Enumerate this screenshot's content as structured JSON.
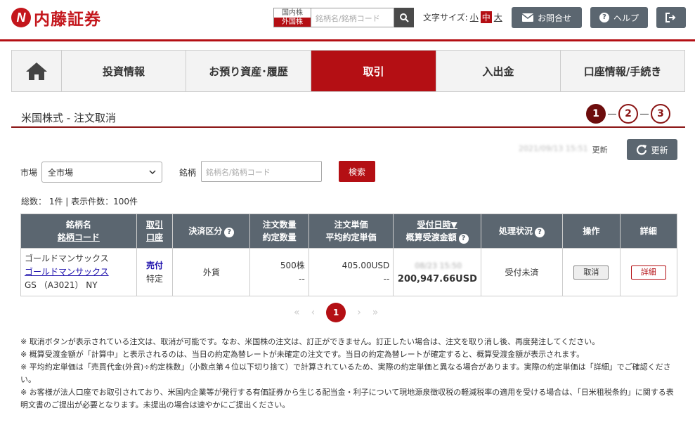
{
  "brand": {
    "logo_mark": "N",
    "name": "内藤証券"
  },
  "header": {
    "market_domestic": "国内株",
    "market_foreign": "外国株",
    "search_placeholder": "銘柄名/銘柄コード",
    "font_size_label": "文字サイズ:",
    "font_small": "小",
    "font_medium": "中",
    "font_large": "大",
    "contact_label": "お問合せ",
    "help_label": "ヘルプ"
  },
  "nav": {
    "items": [
      {
        "label": "投資情報"
      },
      {
        "label": "お預り資産･履歴"
      },
      {
        "label": "取引"
      },
      {
        "label": "入出金"
      },
      {
        "label": "口座情報/手続き"
      }
    ]
  },
  "page": {
    "title": "米国株式 - 注文取消",
    "steps": [
      "1",
      "2",
      "3"
    ],
    "updated_ts": "2021/09/13 15:51",
    "updated_label": "更新",
    "refresh_label": "更新"
  },
  "filters": {
    "market_label": "市場",
    "market_value": "全市場",
    "code_label": "銘柄",
    "code_placeholder": "銘柄名/銘柄コード",
    "search_label": "検索",
    "counts": "総数： 1件 | 表示件数：100件"
  },
  "table": {
    "headers": {
      "name_1": "銘柄名",
      "name_2": "銘柄コード",
      "type_1": "取引",
      "type_2": "口座",
      "settle": "決済区分",
      "qty_1": "注文数量",
      "qty_2": "約定数量",
      "price_1": "注文単価",
      "price_2": "平均約定単価",
      "date_1": "受付日時▼",
      "date_2": "概算受渡金額",
      "status": "処理状況",
      "action": "操作",
      "detail": "詳細"
    },
    "rows": [
      {
        "name_kana": "ゴールドマンサックス",
        "name_link": "ゴールドマンサックス",
        "code": "GS （A3021） NY",
        "trade": "売付",
        "account": "特定",
        "settle": "外貨",
        "qty": "500株",
        "qty_filled": "--",
        "price": "405.00USD",
        "price_avg": "--",
        "date": "08/23 15:50",
        "amount": "200,947.66USD",
        "status": "受付未済",
        "action": "取消",
        "detail": "詳細"
      }
    ]
  },
  "pager": {
    "first": "«",
    "prev": "‹",
    "current": "1",
    "next": "›",
    "last": "»"
  },
  "notes": [
    "※ 取消ボタンが表示されている注文は、取消が可能です。なお、米国株の注文は、訂正ができません。訂正したい場合は、注文を取り消し後、再度発注してください。",
    "※ 概算受渡金額が「計算中」と表示されるのは、当日の約定為替レートが未確定の注文です。当日の約定為替レートが確定すると、概算受渡金額が表示されます。",
    "※ 平均約定単価は「売買代金(外貨)÷約定株数」（小数点第４位以下切り捨て）で計算されているため、実際の約定単価と異なる場合があります。実際の約定単価は「詳細」でご確認ください。",
    "※ お客様が法人口座でお取引されており、米国内企業等が発行する有価証券から生じる配当金・利子について現地源泉徴収税の軽減税率の適用を受ける場合は、「日米租税条約」に関する表明文書のご提出が必要となります。未提出の場合は速やかにご提出ください。"
  ]
}
